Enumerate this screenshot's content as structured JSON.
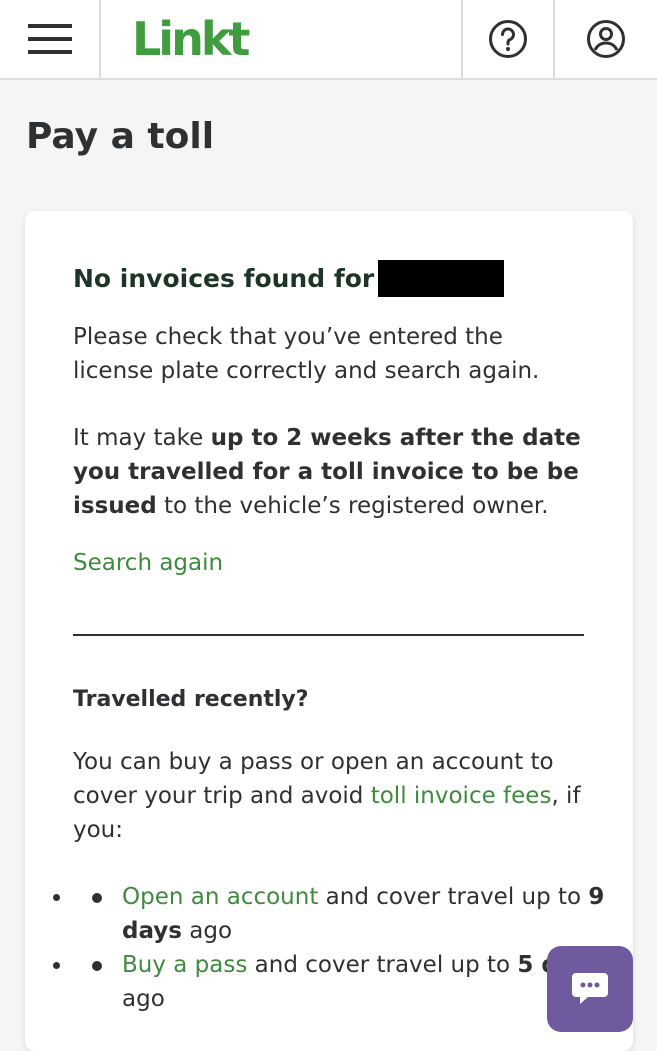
{
  "header": {
    "logo_text": "Linkt",
    "menu_icon": "hamburger-menu-icon",
    "help_icon": "question-circle-icon",
    "account_icon": "user-circle-icon",
    "brand_color": "#3f9c3f"
  },
  "page": {
    "title": "Pay a toll"
  },
  "result": {
    "heading": "No invoices found for",
    "check_text": "Please check that you’ve entered the license plate correctly and search again.",
    "delay_pre": "It may take ",
    "delay_bold": "up to 2 weeks after the date you travelled for a toll invoice to be be issued",
    "delay_post": " to the vehicle’s registered owner.",
    "search_again_link": "Search again"
  },
  "recent": {
    "heading": "Travelled recently?",
    "text_pre": "You can buy a pass or open an account to cover your trip and avoid ",
    "text_link": "toll invoice fees",
    "text_post": ", if you:",
    "bullets": [
      {
        "link": "Open an account",
        "text": " and cover travel up to ",
        "bold": "9 days",
        "tail": " ago"
      },
      {
        "link": "Buy a pass",
        "text": " and cover travel up to ",
        "bold": "5 days",
        "tail": " ago"
      }
    ]
  },
  "chat": {
    "icon": "chat-bubble-icon",
    "color": "#6f5a9e"
  }
}
